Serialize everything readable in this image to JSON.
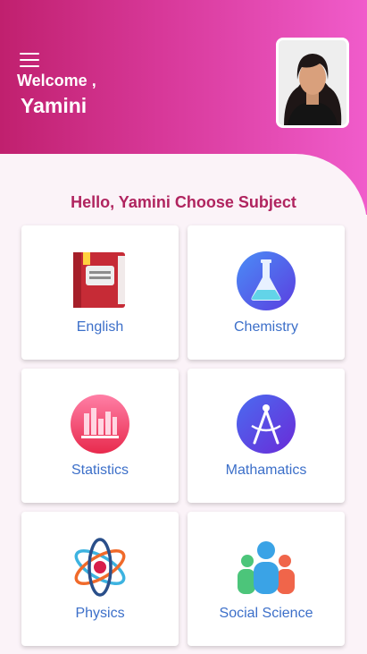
{
  "header": {
    "welcome": "Welcome ,",
    "user_name": "Yamini"
  },
  "main": {
    "heading": "Hello, Yamini Choose Subject",
    "subjects": [
      {
        "label": "English",
        "icon": "book-icon"
      },
      {
        "label": "Chemistry",
        "icon": "flask-icon"
      },
      {
        "label": "Statistics",
        "icon": "bar-chart-icon"
      },
      {
        "label": "Mathamatics",
        "icon": "compass-icon"
      },
      {
        "label": "Physics",
        "icon": "atom-icon"
      },
      {
        "label": "Social Science",
        "icon": "people-icon"
      }
    ]
  },
  "colors": {
    "header_start": "#c0206e",
    "header_end": "#f05ccb",
    "heading": "#b0245f",
    "card_label": "#3c6fc9"
  }
}
